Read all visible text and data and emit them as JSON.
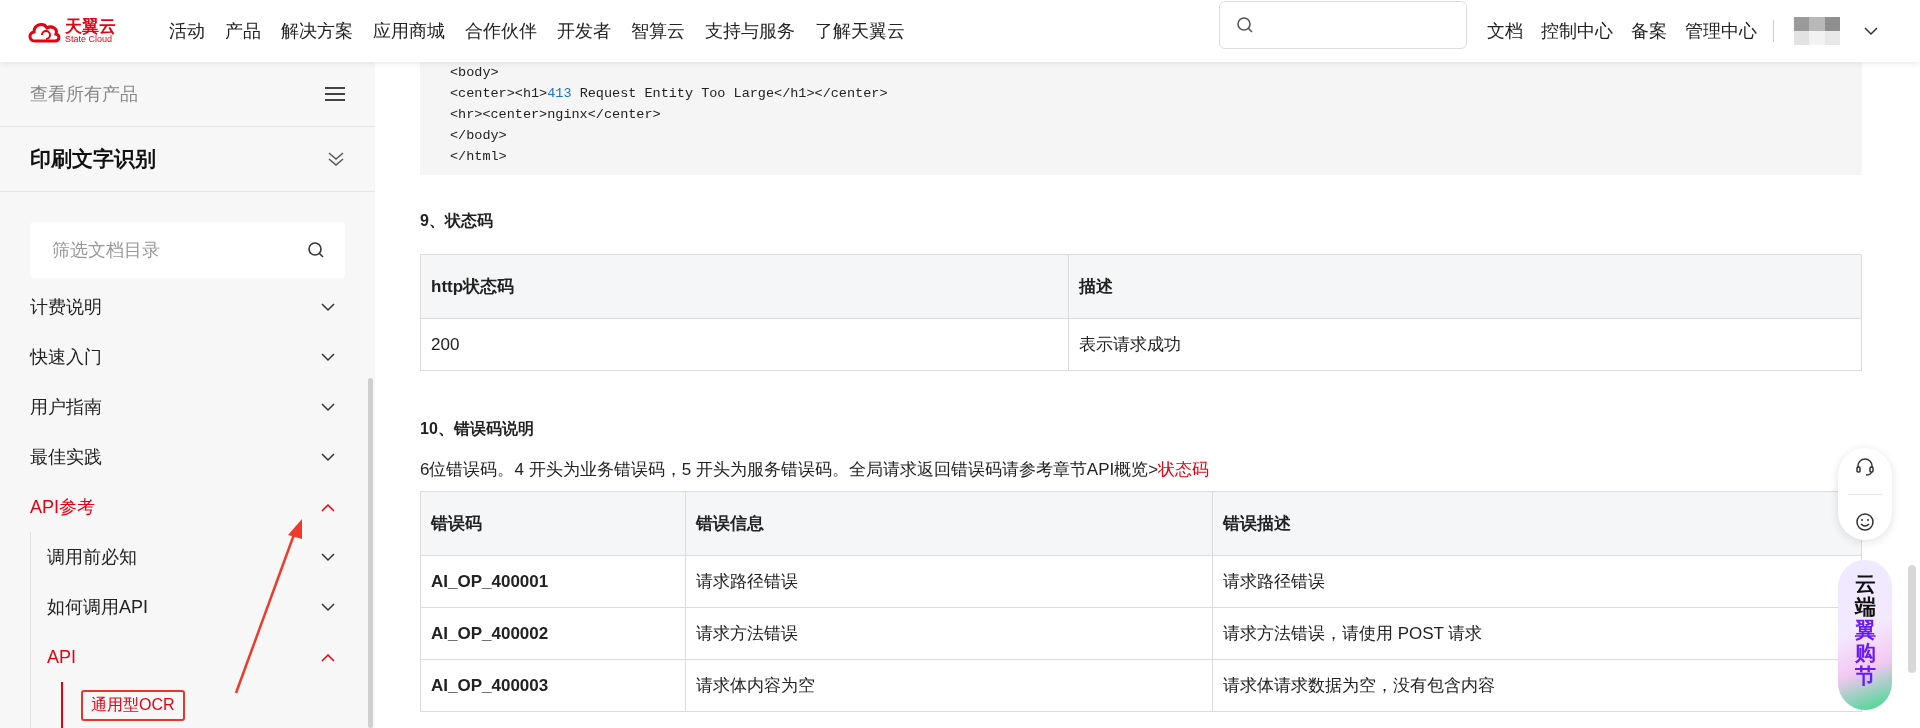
{
  "header": {
    "logo": {
      "name": "天翼云",
      "tagline": "State Cloud"
    },
    "nav": [
      "活动",
      "产品",
      "解决方案",
      "应用商城",
      "合作伙伴",
      "开发者",
      "智算云",
      "支持与服务",
      "了解天翼云"
    ],
    "links": [
      "文档",
      "控制中心",
      "备案",
      "管理中心"
    ]
  },
  "sidebar": {
    "all_products": "查看所有产品",
    "product": "印刷文字识别",
    "filter": {
      "placeholder": "筛选文档目录"
    },
    "tree": [
      {
        "kind": "folder",
        "label": "计费说明",
        "expanded": false
      },
      {
        "kind": "folder",
        "label": "快速入门",
        "expanded": false
      },
      {
        "kind": "folder",
        "label": "用户指南",
        "expanded": false
      },
      {
        "kind": "folder",
        "label": "最佳实践",
        "expanded": false
      },
      {
        "kind": "folder",
        "label": "API参考",
        "expanded": true,
        "children": [
          {
            "kind": "folder",
            "label": "调用前必知",
            "expanded": false
          },
          {
            "kind": "folder",
            "label": "如何调用API",
            "expanded": false
          },
          {
            "kind": "folder",
            "label": "API",
            "expanded": true,
            "children": [
              {
                "kind": "page",
                "label": "通用型OCR",
                "selected": true,
                "boxed": true
              }
            ]
          }
        ]
      }
    ]
  },
  "content": {
    "code": [
      [
        {
          "kind": "plain",
          "text": "<body>"
        }
      ],
      [
        {
          "kind": "plain",
          "text": "<center><h1>"
        },
        {
          "kind": "number",
          "text": "413"
        },
        {
          "kind": "plain",
          "text": " Request Entity Too Large</h1></center>"
        }
      ],
      [
        {
          "kind": "plain",
          "text": "<hr><center>nginx</center>"
        }
      ],
      [
        {
          "kind": "plain",
          "text": "</body>"
        }
      ],
      [
        {
          "kind": "plain",
          "text": "</html>"
        }
      ]
    ],
    "status_heading": "9、状态码",
    "status_table": {
      "columns": [
        "http状态码",
        "描述"
      ],
      "rows": [
        [
          "200",
          "表示请求成功"
        ]
      ]
    },
    "error_heading": "10、错误码说明",
    "error_intro": {
      "text": "6位错误码。4 开头为业务错误码，5 开头为服务错误码。全局请求返回错误码请参考章节API概览>",
      "link": "状态码"
    },
    "error_table": {
      "columns": [
        "错误码",
        "错误信息",
        "错误描述"
      ],
      "rows": [
        [
          "AI_OP_400001",
          "请求路径错误",
          "请求路径错误"
        ],
        [
          "AI_OP_400002",
          "请求方法错误",
          "请求方法错误，请使用 POST 请求"
        ],
        [
          "AI_OP_400003",
          "请求体内容为空",
          "请求体请求数据为空，没有包含内容"
        ]
      ]
    }
  },
  "promo": {
    "line_1": "云端",
    "line_2": "翼购节"
  }
}
